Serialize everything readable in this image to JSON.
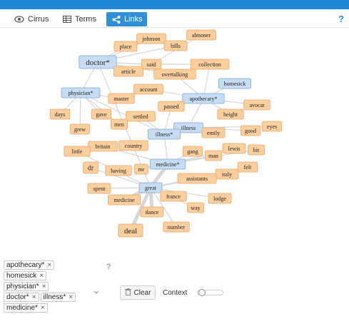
{
  "tabs": [
    {
      "label": "Cirrus",
      "icon": "eye-icon",
      "active": false
    },
    {
      "label": "Terms",
      "icon": "table-icon",
      "active": false
    },
    {
      "label": "Links",
      "icon": "share-icon",
      "active": true
    }
  ],
  "help_label": "?",
  "colors": {
    "topbar": "#1e88d4",
    "tab_active": "#2f8fd8",
    "keyword_fill": "#c6dcf2",
    "keyword_stroke": "#7fa9d4",
    "context_fill": "#fbcf9d",
    "context_stroke": "#e8a86a",
    "link": "#d6d6d6"
  },
  "graph": {
    "nodes": [
      {
        "id": "almoner",
        "label": "almoner",
        "kind": "context",
        "size": "s"
      },
      {
        "id": "johnson",
        "label": "johnson",
        "kind": "context",
        "size": "s"
      },
      {
        "id": "place",
        "label": "place",
        "kind": "context",
        "size": "s"
      },
      {
        "id": "bills",
        "label": "bills",
        "kind": "context",
        "size": "s"
      },
      {
        "id": "doctor",
        "label": "doctor*",
        "kind": "keyword",
        "size": "l"
      },
      {
        "id": "said",
        "label": "said",
        "kind": "context",
        "size": "s"
      },
      {
        "id": "collection",
        "label": "collection",
        "kind": "context",
        "size": "s"
      },
      {
        "id": "article",
        "label": "article",
        "kind": "context",
        "size": "s"
      },
      {
        "id": "overtalking",
        "label": "overtalking",
        "kind": "context",
        "size": "s"
      },
      {
        "id": "homesick",
        "label": "homesick",
        "kind": "keyword",
        "size": "s"
      },
      {
        "id": "account",
        "label": "account",
        "kind": "context",
        "size": "s"
      },
      {
        "id": "physician",
        "label": "physician*",
        "kind": "keyword",
        "size": "s"
      },
      {
        "id": "master",
        "label": "master",
        "kind": "context",
        "size": "s"
      },
      {
        "id": "apothecary",
        "label": "apothecary*",
        "kind": "keyword",
        "size": "s"
      },
      {
        "id": "avocat",
        "label": "avocat",
        "kind": "context",
        "size": "s"
      },
      {
        "id": "passed",
        "label": "passed",
        "kind": "context",
        "size": "s"
      },
      {
        "id": "days",
        "label": "days",
        "kind": "context",
        "size": "s"
      },
      {
        "id": "gave",
        "label": "gave",
        "kind": "context",
        "size": "s"
      },
      {
        "id": "settled",
        "label": "settled",
        "kind": "context",
        "size": "s"
      },
      {
        "id": "height",
        "label": "height",
        "kind": "context",
        "size": "s"
      },
      {
        "id": "men",
        "label": "men",
        "kind": "context",
        "size": "s"
      },
      {
        "id": "eyes",
        "label": "eyes",
        "kind": "context",
        "size": "s"
      },
      {
        "id": "grew",
        "label": "grew",
        "kind": "context",
        "size": "s"
      },
      {
        "id": "illness",
        "label": "illness",
        "kind": "keyword",
        "size": "s"
      },
      {
        "id": "good",
        "label": "good",
        "kind": "context",
        "size": "s"
      },
      {
        "id": "illness2",
        "label": "illness*",
        "kind": "keyword",
        "size": "s"
      },
      {
        "id": "emily",
        "label": "emily",
        "kind": "context",
        "size": "s"
      },
      {
        "id": "britain",
        "label": "britain",
        "kind": "context",
        "size": "s"
      },
      {
        "id": "country",
        "label": "country",
        "kind": "context",
        "size": "s"
      },
      {
        "id": "little",
        "label": "little",
        "kind": "context",
        "size": "s"
      },
      {
        "id": "lewis",
        "label": "lewis",
        "kind": "context",
        "size": "s"
      },
      {
        "id": "gang",
        "label": "gang",
        "kind": "context",
        "size": "s"
      },
      {
        "id": "bit",
        "label": "bit",
        "kind": "context",
        "size": "s"
      },
      {
        "id": "man",
        "label": "man",
        "kind": "context",
        "size": "s"
      },
      {
        "id": "medicine2",
        "label": "medicine*",
        "kind": "keyword",
        "size": "s"
      },
      {
        "id": "dr",
        "label": "dr",
        "kind": "context",
        "size": "m"
      },
      {
        "id": "felt",
        "label": "felt",
        "kind": "context",
        "size": "s"
      },
      {
        "id": "having",
        "label": "having",
        "kind": "context",
        "size": "s"
      },
      {
        "id": "mr",
        "label": "mr",
        "kind": "context",
        "size": "s"
      },
      {
        "id": "italy",
        "label": "italy",
        "kind": "context",
        "size": "s"
      },
      {
        "id": "assistants",
        "label": "assistants",
        "kind": "context",
        "size": "s"
      },
      {
        "id": "great",
        "label": "great",
        "kind": "keyword",
        "size": "s"
      },
      {
        "id": "spent",
        "label": "spent",
        "kind": "context",
        "size": "s"
      },
      {
        "id": "france",
        "label": "france",
        "kind": "context",
        "size": "s"
      },
      {
        "id": "lodge",
        "label": "lodge",
        "kind": "context",
        "size": "s"
      },
      {
        "id": "medicine",
        "label": "medicine",
        "kind": "context",
        "size": "s"
      },
      {
        "id": "way",
        "label": "way",
        "kind": "context",
        "size": "s"
      },
      {
        "id": "dance",
        "label": "dance",
        "kind": "context",
        "size": "s"
      },
      {
        "id": "number",
        "label": "number",
        "kind": "context",
        "size": "s"
      },
      {
        "id": "deal",
        "label": "deal",
        "kind": "context",
        "size": "l"
      }
    ],
    "links": [
      [
        "doctor",
        "place"
      ],
      [
        "doctor",
        "said"
      ],
      [
        "doctor",
        "article"
      ],
      [
        "doctor",
        "johnson"
      ],
      [
        "doctor",
        "physician"
      ],
      [
        "doctor",
        "overtalking"
      ],
      [
        "doctor",
        "bills"
      ],
      [
        "doctor",
        "great"
      ],
      [
        "said",
        "collection"
      ],
      [
        "said",
        "almoner"
      ],
      [
        "overtalking",
        "apothecary"
      ],
      [
        "apothecary",
        "homesick"
      ],
      [
        "apothecary",
        "passed"
      ],
      [
        "apothecary",
        "avocat"
      ],
      [
        "apothecary",
        "height"
      ],
      [
        "apothecary",
        "illness"
      ],
      [
        "apothecary",
        "collection"
      ],
      [
        "apothecary",
        "account"
      ],
      [
        "physician",
        "days"
      ],
      [
        "physician",
        "gave"
      ],
      [
        "physician",
        "master"
      ],
      [
        "physician",
        "grew"
      ],
      [
        "physician",
        "men"
      ],
      [
        "physician",
        "illness2"
      ],
      [
        "illness2",
        "settled"
      ],
      [
        "illness2",
        "country"
      ],
      [
        "illness2",
        "medicine2"
      ],
      [
        "illness2",
        "passed"
      ],
      [
        "illness",
        "emily"
      ],
      [
        "illness",
        "good"
      ],
      [
        "illness",
        "illness2"
      ],
      [
        "illness",
        "eyes"
      ],
      [
        "medicine2",
        "gang"
      ],
      [
        "medicine2",
        "man"
      ],
      [
        "medicine2",
        "mr"
      ],
      [
        "medicine2",
        "having"
      ],
      [
        "medicine2",
        "great"
      ],
      [
        "medicine2",
        "britain"
      ],
      [
        "medicine2",
        "lewis"
      ],
      [
        "medicine2",
        "bit"
      ],
      [
        "great",
        "spent"
      ],
      [
        "great",
        "france"
      ],
      [
        "great",
        "medicine"
      ],
      [
        "great",
        "dance"
      ],
      [
        "great",
        "way"
      ],
      [
        "great",
        "number"
      ],
      [
        "great",
        "deal"
      ],
      [
        "great",
        "assistants"
      ],
      [
        "great",
        "lodge"
      ],
      [
        "great",
        "italy"
      ],
      [
        "great",
        "felt"
      ],
      [
        "great",
        "little"
      ],
      [
        "great",
        "dr"
      ]
    ]
  },
  "filter_tags": [
    [
      "apothecary*"
    ],
    [
      "homesick"
    ],
    [
      "physician*"
    ],
    [
      "doctor*",
      "illness*"
    ],
    [
      "medicine*"
    ]
  ],
  "remove_glyph": "×",
  "help_mark": "?",
  "clear_label": "Clear",
  "context_label": "Context",
  "context_slider_value": 0
}
